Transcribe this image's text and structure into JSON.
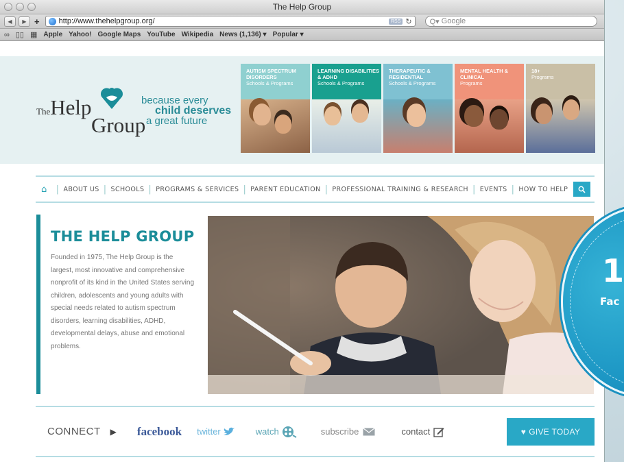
{
  "browser": {
    "title": "The Help Group",
    "url": "http://www.thehelpgroup.org/",
    "rss": "RSS",
    "search_placeholder": "Google",
    "bookmarks": [
      "Apple",
      "Yahoo!",
      "Google Maps",
      "YouTube",
      "Wikipedia",
      "News (1,136) ▾",
      "Popular ▾"
    ]
  },
  "logo": {
    "the": "The",
    "help": "Help",
    "group": "Group",
    "tagline1": "because every",
    "tagline2": "child deserves",
    "tagline3": "a great future"
  },
  "tiles": [
    {
      "title": "AUTISM SPECTRUM DISORDERS",
      "sub": "Schools & Programs",
      "color": "#8fd0d0"
    },
    {
      "title": "LEARNING DISABILITIES & ADHD",
      "sub": "Schools & Programs",
      "color": "#19a08f"
    },
    {
      "title": "THERAPEUTIC & RESIDENTIAL",
      "sub": "Schools & Programs",
      "color": "#7fc1d2"
    },
    {
      "title": "MENTAL HEALTH & CLINICAL",
      "sub": "Programs",
      "color": "#f0937a"
    },
    {
      "title": "18+",
      "sub": "Programs",
      "color": "#c9bfa6"
    }
  ],
  "nav": {
    "items": [
      "ABOUT US",
      "SCHOOLS",
      "PROGRAMS & SERVICES",
      "PARENT EDUCATION",
      "PROFESSIONAL TRAINING & RESEARCH",
      "EVENTS",
      "HOW TO HELP"
    ]
  },
  "about": {
    "heading": "THE HELP GROUP",
    "body": "Founded in 1975, The Help Group is the largest, most innovative and comprehensive nonprofit of its kind in the United States serving children, adolescents and young adults with special needs related to autism spectrum disorders, learning disabilities, ADHD, developmental delays, abuse and emotional problems."
  },
  "connect": {
    "label": "CONNECT",
    "facebook": "facebook",
    "twitter": "twitter",
    "watch": "watch",
    "subscribe": "subscribe",
    "contact": "contact",
    "give": "GIVE TODAY"
  },
  "badge": {
    "number": "1",
    "text": "Fac"
  },
  "colors": {
    "teal": "#1b8d99",
    "accent_blue": "#29a8c6",
    "header_bg": "#e6f1f2"
  }
}
